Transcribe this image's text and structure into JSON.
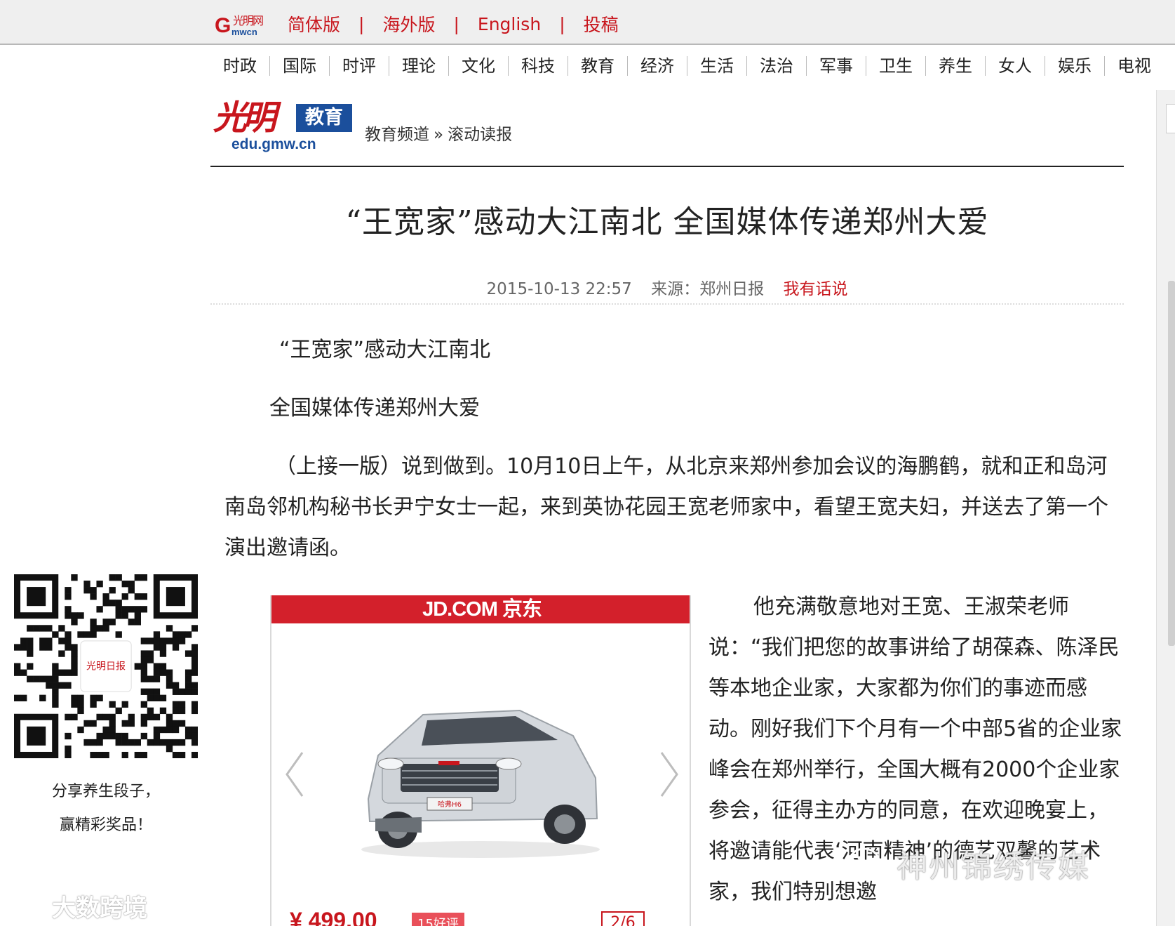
{
  "topbar": {
    "logo_g": "G",
    "logo_calli": "光明网",
    "logo_sub": "mwcn",
    "links": [
      "简体版",
      "海外版",
      "English",
      "投稿"
    ],
    "separator": "|"
  },
  "nav": {
    "items": [
      "时政",
      "国际",
      "时评",
      "理论",
      "文化",
      "科技",
      "教育",
      "经济",
      "生活",
      "法治",
      "军事",
      "卫生",
      "养生",
      "女人",
      "娱乐",
      "电视"
    ]
  },
  "channel": {
    "logo_calli": "光明",
    "logo_badge": "教育",
    "logo_domain": "edu.gmw.cn",
    "breadcrumb": [
      "教育频道",
      "滚动读报"
    ],
    "breadcrumb_sep": "»"
  },
  "article": {
    "title": "“王宽家”感动大江南北  全国媒体传递郑州大爱",
    "datetime": "2015-10-13 22:57",
    "source": "来源：郑州日报",
    "comment_link": "我有话说",
    "subheading_1": "“王宽家”感动大江南北",
    "subheading_2": "全国媒体传递郑州大爱",
    "paragraph_1": "（上接一版）说到做到。10月10日上午，从北京来郑州参加会议的海鹏鹤，就和正和岛河南岛邻机构秘书长尹宁女士一起，来到英协花园王宽老师家中，看望王宽夫妇，并送去了第一个演出邀请函。",
    "paragraph_2": "他充满敬意地对王宽、王淑荣老师说：“我们把您的故事讲给了胡葆森、陈泽民等本地企业家，大家都为你们的事迹而感动。刚好我们下个月有一个中部5省的企业家峰会在郑州举行，全国大概有2000个企业家参会，征得主办方的同意，在欢迎晚宴上，将邀请能代表‘河南精神’的德艺双馨的艺术家，我们特别想邀"
  },
  "ad": {
    "brand": "JD.COM 京东",
    "price": "¥ 499.00",
    "review_badge": "15好评",
    "pager": "2/6",
    "car_plate": "哈弗H6"
  },
  "qr": {
    "center_text": "光明日报",
    "caption_line_1": "分享养生段子，",
    "caption_line_2": "赢精彩奖品！"
  },
  "watermarks": {
    "left": "大数跨境",
    "right": "神州锦绣传媒"
  },
  "colors": {
    "brand_red": "#c8161d",
    "brand_blue": "#1b4f9c",
    "jd_red": "#d3202b"
  }
}
